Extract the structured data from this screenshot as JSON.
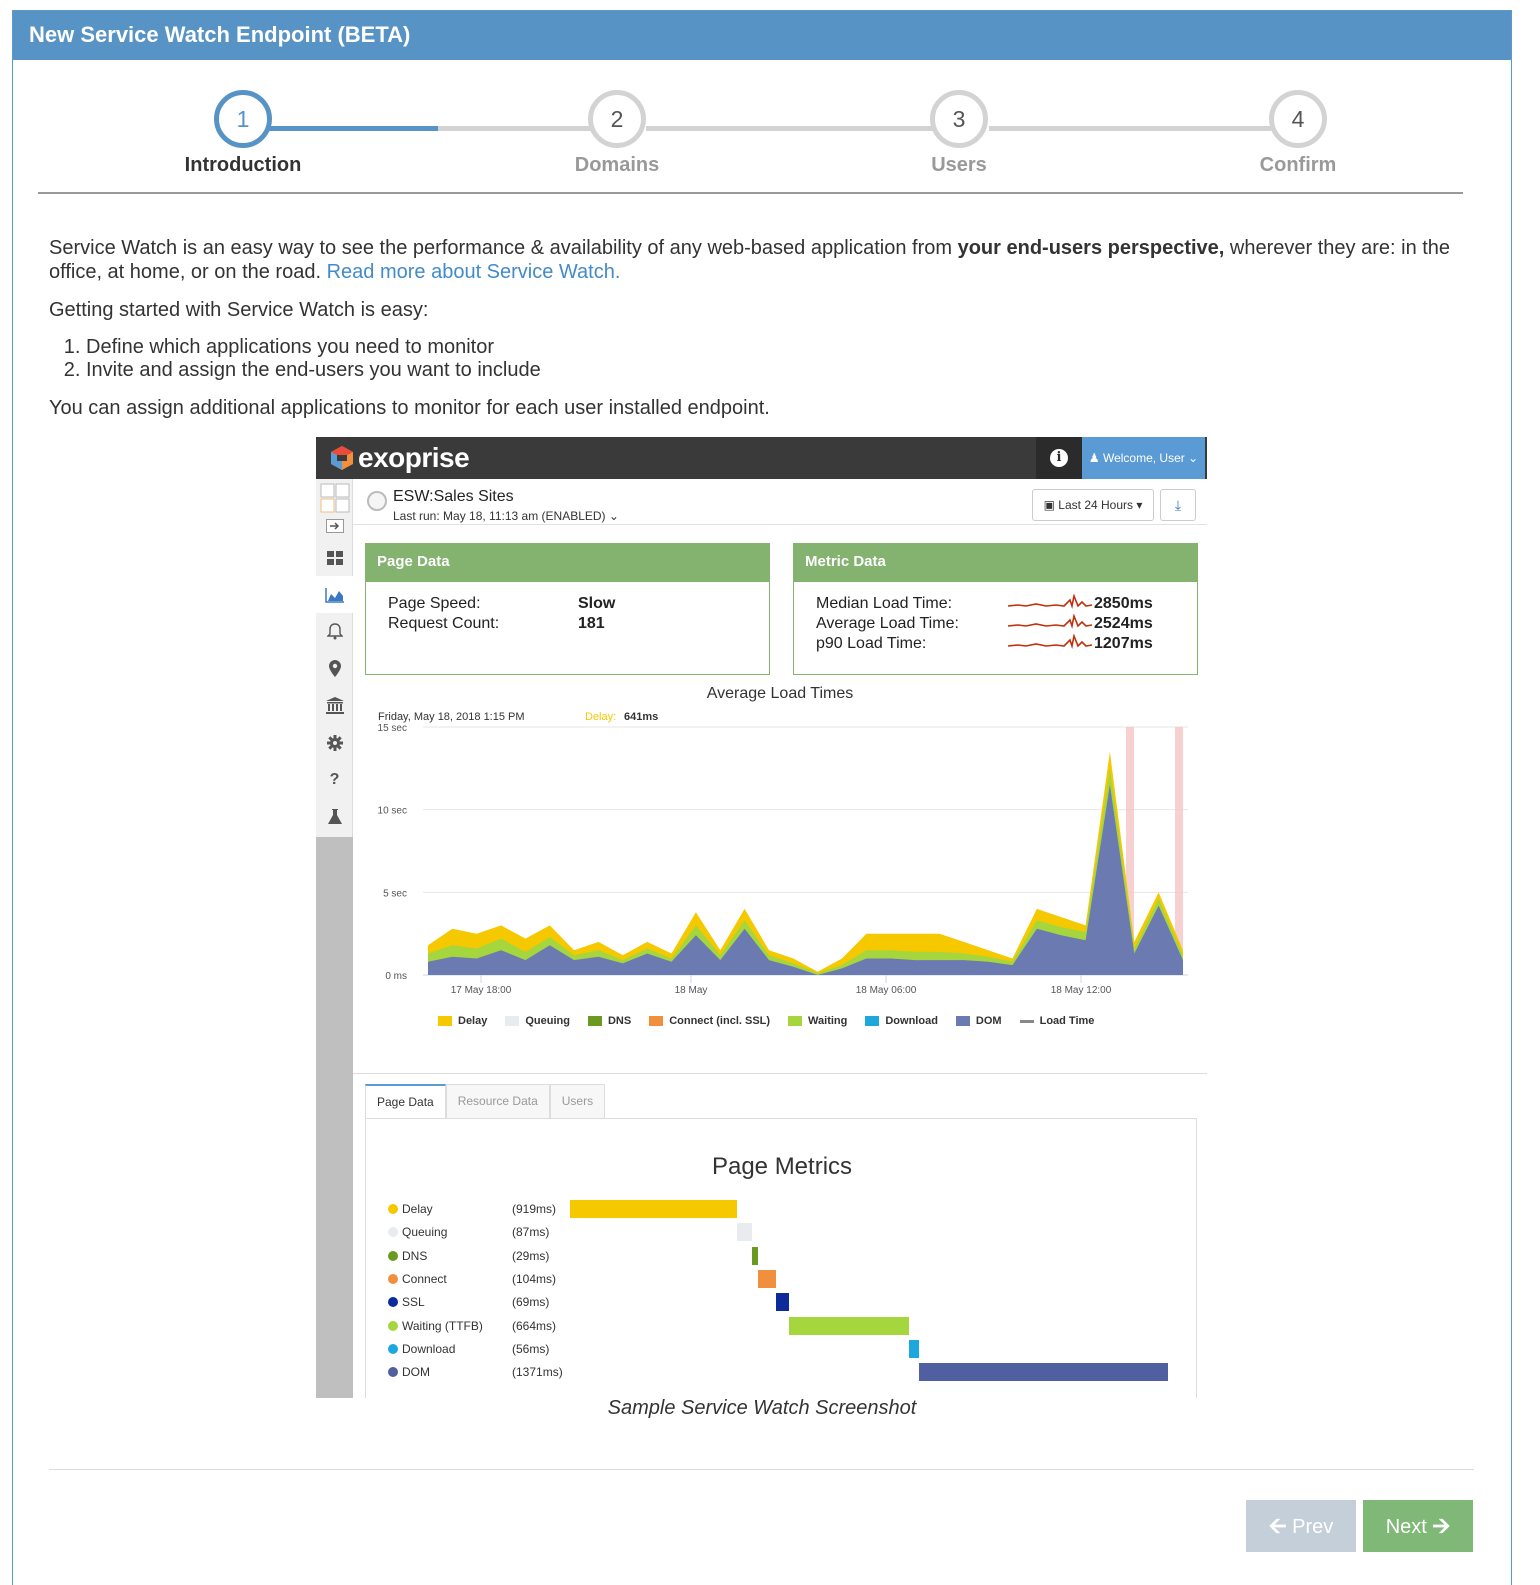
{
  "dialog": {
    "title": "New Service Watch Endpoint (BETA)"
  },
  "wizard": {
    "steps": [
      {
        "num": "1",
        "label": "Introduction"
      },
      {
        "num": "2",
        "label": "Domains"
      },
      {
        "num": "3",
        "label": "Users"
      },
      {
        "num": "4",
        "label": "Confirm"
      }
    ]
  },
  "intro": {
    "p1_start": "Service Watch is an easy way to see the performance & availability of any web-based application from ",
    "p1_bold": "your end-users perspective,",
    "p1_end": " wherever they are: in the office, at home, or on the road. ",
    "p1_link": "Read more about Service Watch.",
    "p2": "Getting started with Service Watch is easy:",
    "steps": [
      "Define which applications you need to monitor",
      "Invite and assign the end-users you want to include"
    ],
    "p3": "You can assign additional applications to monitor for each user installed endpoint."
  },
  "screenshot": {
    "logo": "exoprise",
    "welcome": "Welcome, User",
    "sensor_name": "ESW:Sales Sites",
    "last_run": "Last run: May 18, 11:13 am (ENABLED)",
    "range_button": "Last 24 Hours",
    "page_data": {
      "title": "Page Data",
      "rows": [
        {
          "label": "Page Speed:",
          "value": "Slow"
        },
        {
          "label": "Request Count:",
          "value": "181"
        }
      ]
    },
    "metric_data": {
      "title": "Metric Data",
      "rows": [
        {
          "label": "Median Load Time:",
          "value": "2850ms"
        },
        {
          "label": "Average Load Time:",
          "value": "2524ms"
        },
        {
          "label": "p90 Load Time:",
          "value": "1207ms"
        }
      ]
    },
    "tabs": [
      "Page Data",
      "Resource Data",
      "Users"
    ],
    "page_metrics": {
      "title": "Page Metrics",
      "rows": [
        {
          "name": "Delay",
          "value": "(919ms)",
          "color": "#f5c800"
        },
        {
          "name": "Queuing",
          "value": "(87ms)",
          "color": "#e8ecef"
        },
        {
          "name": "DNS",
          "value": "(29ms)",
          "color": "#6a9a22"
        },
        {
          "name": "Connect",
          "value": "(104ms)",
          "color": "#f08f3e"
        },
        {
          "name": "SSL",
          "value": "(69ms)",
          "color": "#0d2a9b"
        },
        {
          "name": "Waiting (TTFB)",
          "value": "(664ms)",
          "color": "#a5d63e"
        },
        {
          "name": "Download",
          "value": "(56ms)",
          "color": "#1ea7dc"
        },
        {
          "name": "DOM",
          "value": "(1371ms)",
          "color": "#4f5f9f"
        }
      ]
    },
    "caption": "Sample Service Watch Screenshot"
  },
  "chart_data": {
    "type": "area",
    "title": "Average Load Times",
    "tooltip": {
      "time": "Friday, May 18, 2018 1:15 PM",
      "label": "Delay:",
      "value": "641ms"
    },
    "y_ticks": [
      "0 ms",
      "5 sec",
      "10 sec",
      "15 sec"
    ],
    "ylim": [
      0,
      15
    ],
    "x_ticks": [
      "17 May 18:00",
      "18 May",
      "18 May 06:00",
      "18 May 12:00"
    ],
    "legend": [
      "Delay",
      "Queuing",
      "DNS",
      "Connect (incl. SSL)",
      "Waiting",
      "Download",
      "DOM",
      "Load Time"
    ],
    "colors": {
      "Delay": "#f5c800",
      "Queuing": "#e8ecef",
      "DNS": "#6a9a22",
      "Connect (incl. SSL)": "#f08f3e",
      "Waiting": "#a5d63e",
      "Download": "#1ea7dc",
      "DOM": "#6b7ab0",
      "Load Time": "#888888"
    },
    "series_total": [
      1.8,
      2.8,
      2.5,
      3.0,
      2.2,
      3.0,
      1.5,
      2.0,
      1.2,
      2.0,
      1.3,
      3.8,
      1.5,
      4.0,
      1.5,
      1.0,
      0.2,
      1.0,
      2.5,
      2.5,
      2.5,
      2.5,
      2.0,
      1.5,
      1.0,
      4.0,
      3.5,
      3.0,
      13.5,
      2.0,
      5.0,
      1.5
    ],
    "series_waiting": [
      1.3,
      1.8,
      1.6,
      2.2,
      1.4,
      2.3,
      1.2,
      1.5,
      0.9,
      1.6,
      1.0,
      3.0,
      1.2,
      3.3,
      1.2,
      0.7,
      0.1,
      0.6,
      1.5,
      1.5,
      1.4,
      1.4,
      1.3,
      1.1,
      0.8,
      3.3,
      2.9,
      2.6,
      12.5,
      1.6,
      4.6,
      1.2
    ],
    "series_dom": [
      0.8,
      1.1,
      1.0,
      1.5,
      0.9,
      1.8,
      0.9,
      1.1,
      0.7,
      1.3,
      0.8,
      2.4,
      0.9,
      2.8,
      0.9,
      0.5,
      0.0,
      0.4,
      1.0,
      1.0,
      0.9,
      0.9,
      0.9,
      0.8,
      0.6,
      2.8,
      2.4,
      2.1,
      11.5,
      1.3,
      4.2,
      0.9
    ]
  },
  "footer": {
    "prev": "Prev",
    "next": "Next"
  }
}
